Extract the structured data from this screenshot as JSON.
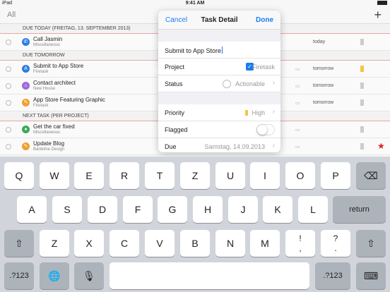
{
  "status": {
    "device": "iPad",
    "time": "9:41 AM",
    "wifi": "wifi-icon",
    "battery": "battery-icon"
  },
  "listbar": {
    "all_label": "All",
    "add_label": "+"
  },
  "sections": [
    {
      "header": "DUE TODAY (FREITAG, 13. SEPTEMBER 2013)",
      "rows": [
        {
          "title": "Call Jasmin",
          "sub": "Miscellaneous",
          "icon": "phone-icon",
          "icon_color": "#2d7de0",
          "note": "",
          "due": "today",
          "prio_color": "#cccccc",
          "flag": ""
        }
      ]
    },
    {
      "header": "DUE TOMORROW",
      "rows": [
        {
          "title": "Submit to App Store",
          "sub": "Firetask",
          "icon": "app-icon",
          "icon_color": "#2d7de0",
          "note": "▭",
          "due": "tomorrow",
          "prio_color": "#f5c542",
          "flag": ""
        },
        {
          "title": "Contact architect",
          "sub": "New House",
          "icon": "house-icon",
          "icon_color": "#9b6cd6",
          "note": "▭",
          "due": "tomorrow",
          "prio_color": "#cccccc",
          "flag": ""
        },
        {
          "title": "App Store Featuring Graphic",
          "sub": "Firetask",
          "icon": "pencil-icon",
          "icon_color": "#f0a030",
          "note": "▭",
          "due": "tomorrow",
          "prio_color": "#cccccc",
          "flag": ""
        }
      ]
    },
    {
      "header": "NEXT TASK (PER PROJECT)",
      "rows": [
        {
          "title": "Get the car fixed",
          "sub": "Miscellaneous",
          "icon": "car-icon",
          "icon_color": "#3aaa55",
          "note": "▭",
          "due": "",
          "prio_color": "#cccccc",
          "flag": ""
        },
        {
          "title": "Update Blog",
          "sub": "Bartelme Design",
          "icon": "pencil-icon",
          "icon_color": "#f0a030",
          "note": "▭",
          "due": "",
          "prio_color": "#cccccc",
          "flag": "★"
        }
      ]
    }
  ],
  "popover": {
    "cancel": "Cancel",
    "title": "Task Detail",
    "done": "Done",
    "task_name": "Submit to App Store",
    "project_label": "Project",
    "project_value": "Firetask",
    "status_label": "Status",
    "status_value": "Actionable",
    "priority_label": "Priority",
    "priority_value": "High",
    "flagged_label": "Flagged",
    "due_label": "Due",
    "due_value": "Samstag, 14.09.2013"
  },
  "keyboard": {
    "row1": [
      "Q",
      "W",
      "E",
      "R",
      "T",
      "Z",
      "U",
      "I",
      "O",
      "P"
    ],
    "row2": [
      "A",
      "S",
      "D",
      "F",
      "G",
      "H",
      "J",
      "K",
      "L"
    ],
    "row3": [
      "Z",
      "X",
      "C",
      "V",
      "B",
      "N",
      "M"
    ],
    "excl": [
      "!",
      ","
    ],
    "quest": [
      "?",
      "."
    ],
    "backspace": "⌫",
    "return": "return",
    "shift": "⇧",
    "numbers": ".?123",
    "globe": "🌐",
    "mic": "🎙",
    "hide": "⌨"
  }
}
